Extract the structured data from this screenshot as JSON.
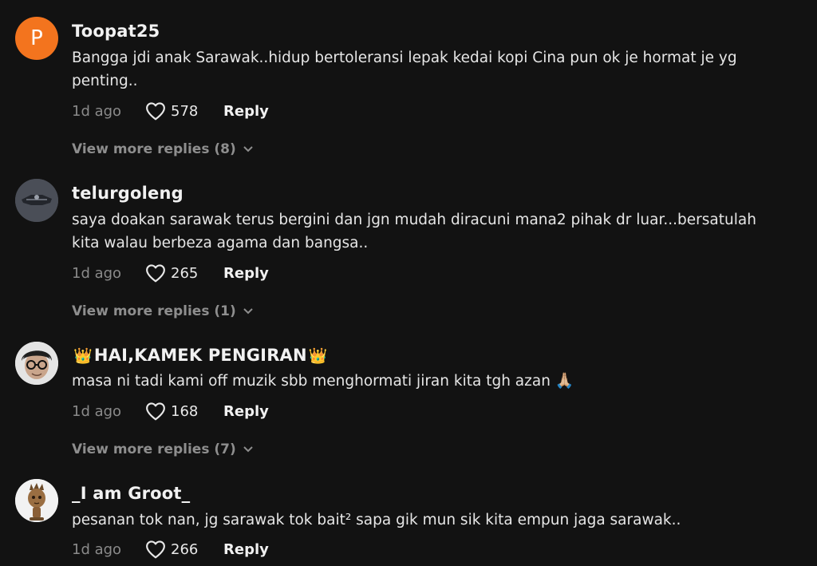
{
  "comments": [
    {
      "username": "Toopat25",
      "avatar_letter": "P",
      "text": "Bangga jdi anak Sarawak..hidup bertoleransi lepak kedai kopi Cina pun ok je hormat je yg penting..",
      "time": "1d ago",
      "likes": "578",
      "reply_label": "Reply",
      "more_replies": "View more replies (8)"
    },
    {
      "username": "telurgoleng",
      "text": "saya doakan sarawak terus bergini dan jgn mudah diracuni mana2 pihak dr luar...bersatulah kita walau berbeza agama dan bangsa..",
      "time": "1d ago",
      "likes": "265",
      "reply_label": "Reply",
      "more_replies": "View more replies (1)"
    },
    {
      "username_prefix": "👑",
      "username": "HAI,KAMEK PENGIRAN",
      "username_suffix": "👑",
      "text": "masa ni tadi kami off muzik sbb menghormati jiran kita tgh azan",
      "text_emoji": "🙏🏼",
      "time": "1d ago",
      "likes": "168",
      "reply_label": "Reply",
      "more_replies": "View more replies (7)"
    },
    {
      "username": "_I am Groot_",
      "text": "pesanan tok nan, jg sarawak tok bait² sapa gik mun sik kita empun jaga sarawak..",
      "time": "1d ago",
      "likes": "266",
      "reply_label": "Reply"
    }
  ],
  "colors": {
    "background": "#121212",
    "avatar_orange": "#f3741e",
    "muted": "#8a8a8a"
  },
  "icons": {
    "like": "heart-outline-icon",
    "expand": "chevron-down-icon"
  }
}
